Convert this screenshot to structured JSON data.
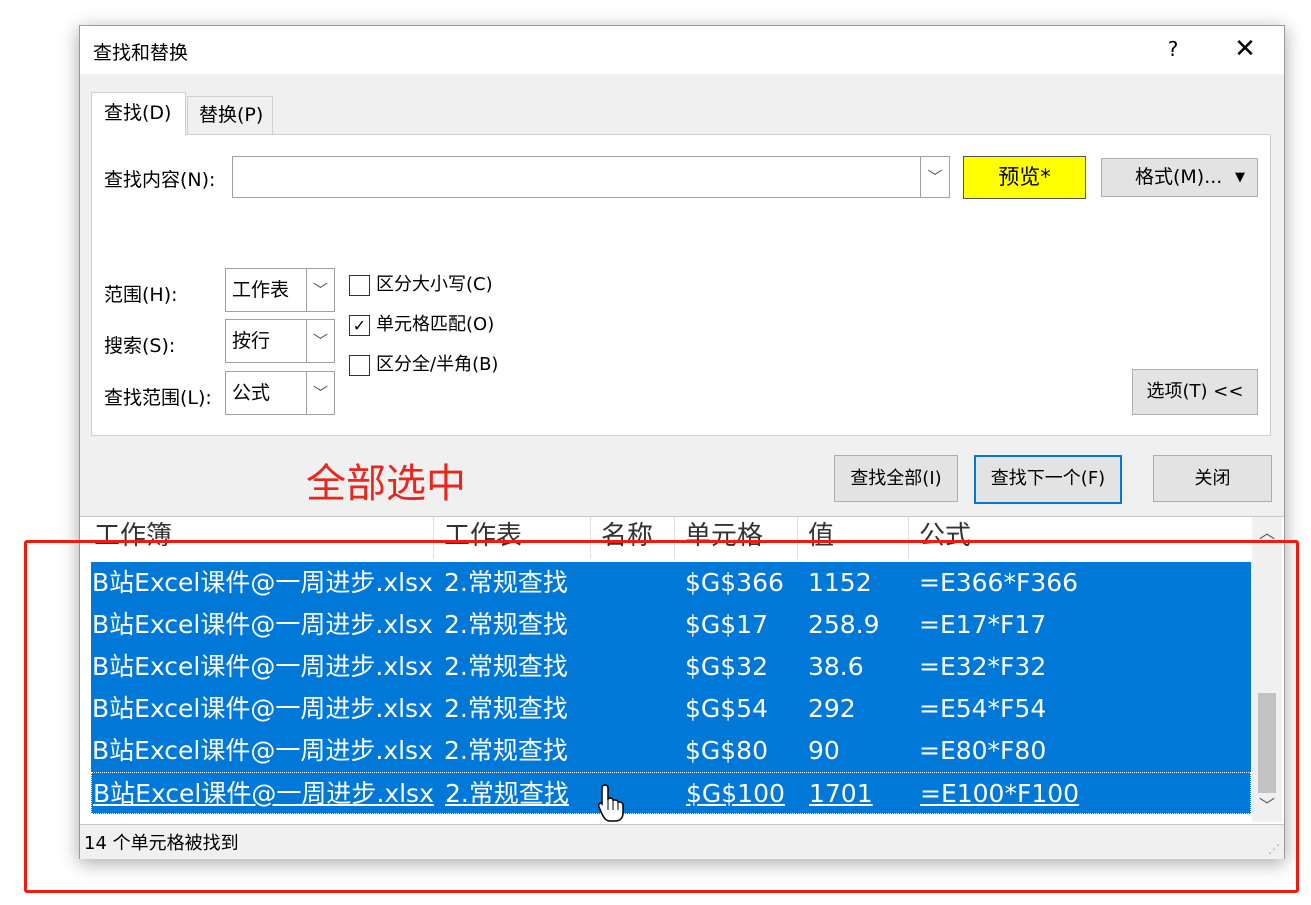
{
  "dialog": {
    "title": "查找和替换",
    "help": "?",
    "close": "✕"
  },
  "tabs": {
    "find": "查找(D)",
    "replace": "替换(P)"
  },
  "find_panel": {
    "find_what_label": "查找内容(N):",
    "find_what_value": "",
    "preview_label": "预览*",
    "format_label": "格式(M)...",
    "within_label": "范围(H):",
    "within_value": "工作表",
    "search_label": "搜索(S):",
    "search_value": "按行",
    "look_in_label": "查找范围(L):",
    "look_in_value": "公式",
    "match_case_label": "区分大小写(C)",
    "match_case_checked": false,
    "match_cell_label": "单元格匹配(O)",
    "match_cell_checked": true,
    "match_width_label": "区分全/半角(B)",
    "match_width_checked": false,
    "options_label": "选项(T) <<"
  },
  "buttons": {
    "find_all": "查找全部(I)",
    "find_next": "查找下一个(F)",
    "close": "关闭"
  },
  "annotation": "全部选中",
  "results": {
    "columns": [
      "工作簿",
      "工作表",
      "名称",
      "单元格",
      "值",
      "公式"
    ],
    "rows": [
      {
        "workbook": "B站Excel课件@一周进步.xlsx",
        "sheet": "2.常规查找",
        "name": "",
        "cell": "$G$366",
        "value": "1152",
        "formula": "=E366*F366"
      },
      {
        "workbook": "B站Excel课件@一周进步.xlsx",
        "sheet": "2.常规查找",
        "name": "",
        "cell": "$G$17",
        "value": "258.9",
        "formula": "=E17*F17"
      },
      {
        "workbook": "B站Excel课件@一周进步.xlsx",
        "sheet": "2.常规查找",
        "name": "",
        "cell": "$G$32",
        "value": "38.6",
        "formula": "=E32*F32"
      },
      {
        "workbook": "B站Excel课件@一周进步.xlsx",
        "sheet": "2.常规查找",
        "name": "",
        "cell": "$G$54",
        "value": "292",
        "formula": "=E54*F54"
      },
      {
        "workbook": "B站Excel课件@一周进步.xlsx",
        "sheet": "2.常规查找",
        "name": "",
        "cell": "$G$80",
        "value": "90",
        "formula": "=E80*F80"
      },
      {
        "workbook": "B站Excel课件@一周进步.xlsx",
        "sheet": "2.常规查找",
        "name": "",
        "cell": "$G$100",
        "value": "1701",
        "formula": "=E100*F100"
      }
    ]
  },
  "status": "14 个单元格被找到",
  "colors": {
    "selection": "#0078d7",
    "preview_bg": "#ffff00",
    "annotation": "#e8271d",
    "highlight_box": "#ef1b0f"
  }
}
